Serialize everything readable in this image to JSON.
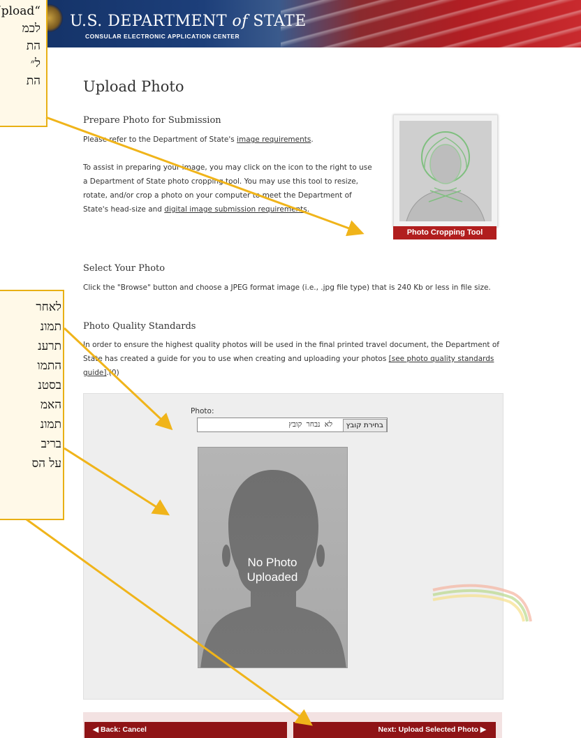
{
  "banner": {
    "title_start": "U.S. DEPARTMENT ",
    "title_of": "of",
    "title_end": " STATE",
    "subtitle": "CONSULAR ELECTRONIC APPLICATION CENTER"
  },
  "page": {
    "title": "Upload Photo",
    "prepare_heading": "Prepare Photo for Submission",
    "prepare_line1_prefix": "Please refer to the Department of State's ",
    "prepare_line1_link": "image requirements",
    "prepare_line1_suffix": ".",
    "assist_text": "To assist in preparing your image, you may click on the icon to the right to use a Department of State photo cropping tool. You may use this tool to resize, rotate, and/or crop a photo on your computer to meet the Department of State's head-size and ",
    "assist_link": "digital image submission requirements",
    "assist_suffix": ".",
    "crop_button": "Photo Cropping Tool",
    "select_heading": "Select Your Photo",
    "select_text": "Click the \"Browse\" button and choose a JPEG format image (i.e., .jpg file type) that is 240 Kb or less in file size.",
    "quality_heading": "Photo Quality Standards",
    "quality_text": "In order to ensure the highest quality photos will be used in the final printed travel document, the Department of State has created a guide for you to use when creating and uploading your photos ",
    "quality_link": "[see photo quality standards guide]",
    "quality_suffix": ".(0)"
  },
  "upload": {
    "photo_label": "Photo:",
    "choose_button": "בחירת קובץ",
    "no_file": "לא נבחר קובץ",
    "no_photo_line1": "No Photo",
    "no_photo_line2": "Uploaded"
  },
  "buttons": {
    "back": "◀ Back: Cancel",
    "next": "Next: Upload Selected Photo ▶"
  },
  "callouts": {
    "top_lines": [
      "“Upload",
      "לכמ",
      "הת",
      "ל״",
      "הת"
    ],
    "mid_lines": [
      "לאחר",
      "תמונ",
      "תרענ",
      "התמו",
      "בסטנ",
      "האמ",
      "תמונ",
      "בריב",
      "על הס"
    ]
  },
  "colors": {
    "accent_red": "#b11e1e",
    "button_red": "#8f1416",
    "callout_border": "#e8b014",
    "arrow": "#f0b41a"
  }
}
